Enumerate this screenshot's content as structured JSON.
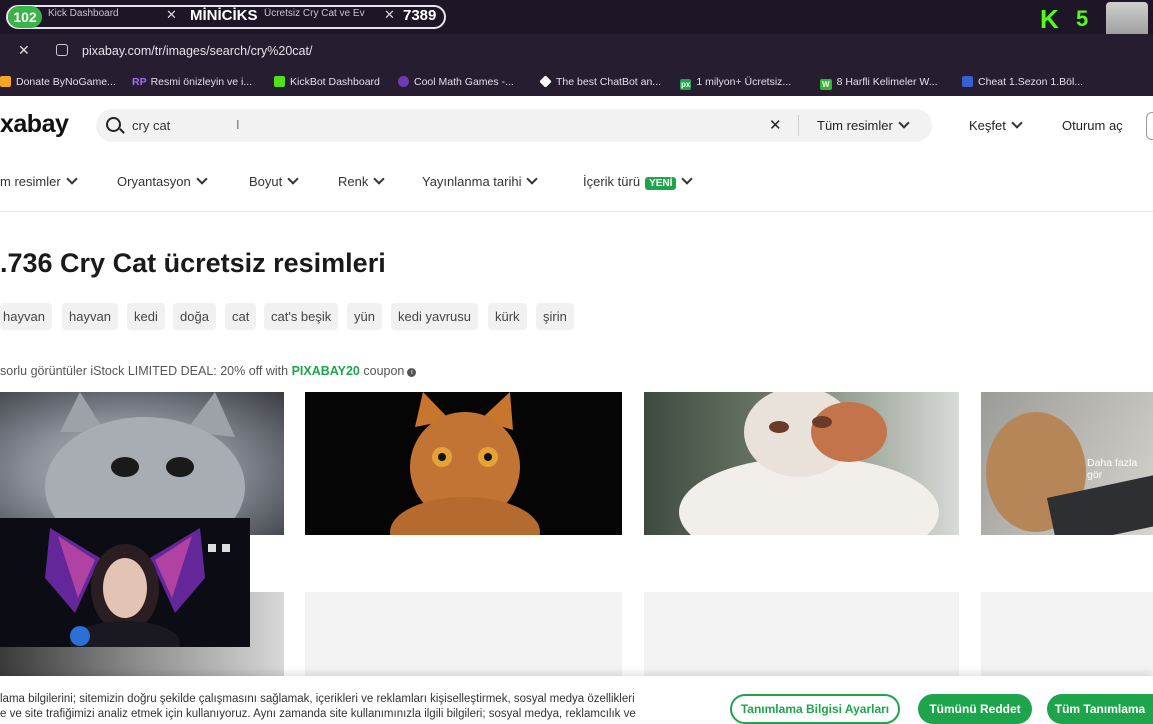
{
  "browser": {
    "tab_count": "102",
    "tabs": [
      {
        "label": "Kick Dashboard"
      },
      {
        "label": "MİNİCİKS"
      },
      {
        "label": "Ücretsiz Cry Cat ve Ev"
      }
    ],
    "tab_counter": "7389",
    "stream_overlay": "5",
    "url": "pixabay.com/tr/images/search/cry%20cat/",
    "bookmarks": [
      {
        "label": "Donate ByNoGame...",
        "color": "#f5a623"
      },
      {
        "label": "Resmi önizleyin ve i...",
        "icon": "RP",
        "color": "#8a4fe0"
      },
      {
        "label": "KickBot Dashboard",
        "color": "#52e01a"
      },
      {
        "label": "Cool Math Games -...",
        "color": "#6d3bb5"
      },
      {
        "label": "The best ChatBot an...",
        "color": "#ffffff"
      },
      {
        "label": "1 milyon+ Ücretsiz...",
        "icon": "px",
        "color": "#1ea54c"
      },
      {
        "label": "8 Harfli Kelimeler W...",
        "icon": "W",
        "color": "#2eb82e"
      },
      {
        "label": "Cheat 1.Sezon 1.Böl...",
        "color": "#3a5fcd"
      }
    ]
  },
  "header": {
    "logo": "xabay",
    "search_value": "cry cat",
    "search_type": "Tüm resimler",
    "nav": [
      "Keşfet",
      "Oturum aç"
    ]
  },
  "filters": [
    {
      "label": "m resimler"
    },
    {
      "label": "Oryantasyon"
    },
    {
      "label": "Boyut"
    },
    {
      "label": "Renk"
    },
    {
      "label": "Yayınlanma tarihi"
    },
    {
      "label": "İçerik türü",
      "badge": "YENİ"
    }
  ],
  "main": {
    "title": ".736 Cry Cat ücretsiz resimleri",
    "tags": [
      "hayvan",
      "hayvan",
      "kedi",
      "doğa",
      "cat",
      "cat's beşik",
      "yün",
      "kedi yavrusu",
      "kürk",
      "şirin"
    ],
    "sponsor_prefix": "sorlu görüntüler iStock LIMITED DEAL: 20% off with ",
    "sponsor_code": "PIXABAY20",
    "sponsor_suffix": " coupon",
    "more_label": "Daha fazla gör"
  },
  "cookie": {
    "line1": "lama bilgilerini; sitemizin doğru şekilde çalışmasını sağlamak, içerikleri ve reklamları kişiselleştirmek, sosyal medya özellikleri",
    "line2": "e ve site trafiğimizi analiz etmek için kullanıyoruz. Aynı zamanda site kullanımınızla ilgili bilgileri; sosyal medya, reklamcılık ve",
    "settings_label": "Tanımlama Bilgisi Ayarları",
    "reject_label": "Tümünü Reddet",
    "accept_label": "Tüm Tanımlama"
  },
  "colors": {
    "accent": "#1ea54c",
    "chrome": "#271d31"
  }
}
